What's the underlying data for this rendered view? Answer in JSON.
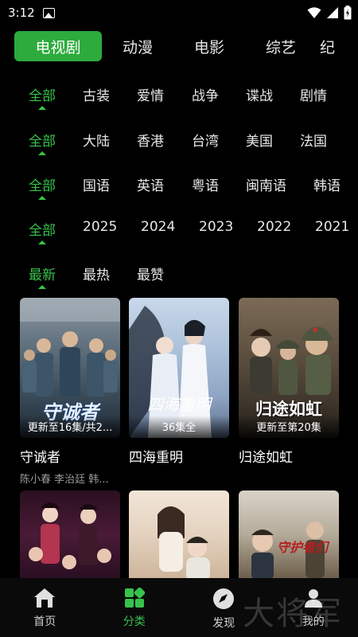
{
  "status_bar": {
    "time": "3:12"
  },
  "top_tabs": [
    {
      "label": "电视剧",
      "active": true
    },
    {
      "label": "动漫",
      "active": false
    },
    {
      "label": "电影",
      "active": false
    },
    {
      "label": "综艺",
      "active": false
    },
    {
      "label": "纪",
      "active": false
    }
  ],
  "filters": {
    "genre": [
      "全部",
      "古装",
      "爱情",
      "战争",
      "谍战",
      "剧情"
    ],
    "region": [
      "全部",
      "大陆",
      "香港",
      "台湾",
      "美国",
      "法国"
    ],
    "language": [
      "全部",
      "国语",
      "英语",
      "粤语",
      "闽南语",
      "韩语"
    ],
    "year": [
      "全部",
      "2025",
      "2024",
      "2023",
      "2022",
      "2021"
    ],
    "sort": [
      "最新",
      "最热",
      "最赞"
    ]
  },
  "cards": [
    {
      "title": "守诚者",
      "status": "更新至16集/共2...",
      "cast": "陈小春  李治廷  韩...",
      "poster_text": "守诚者"
    },
    {
      "title": "四海重明",
      "status": "36集全",
      "cast": "",
      "poster_text": "四海重明"
    },
    {
      "title": "归途如虹",
      "status": "更新至第20集",
      "cast": "",
      "poster_text": "归途如虹"
    },
    {
      "title": "",
      "status": "",
      "cast": "",
      "poster_text": ""
    },
    {
      "title": "",
      "status": "",
      "cast": "",
      "poster_text": ""
    },
    {
      "title": "",
      "status": "",
      "cast": "",
      "poster_text": "守护者们"
    }
  ],
  "bottom_nav": [
    {
      "label": "首页",
      "icon": "home-icon",
      "active": false
    },
    {
      "label": "分类",
      "icon": "category-icon",
      "active": true
    },
    {
      "label": "发现",
      "icon": "compass-icon",
      "active": false
    },
    {
      "label": "我的",
      "icon": "profile-icon",
      "active": false
    }
  ],
  "watermark": "大将军",
  "colors": {
    "accent": "#2dab3c",
    "accent_text": "#38c24c",
    "background": "#000000"
  }
}
